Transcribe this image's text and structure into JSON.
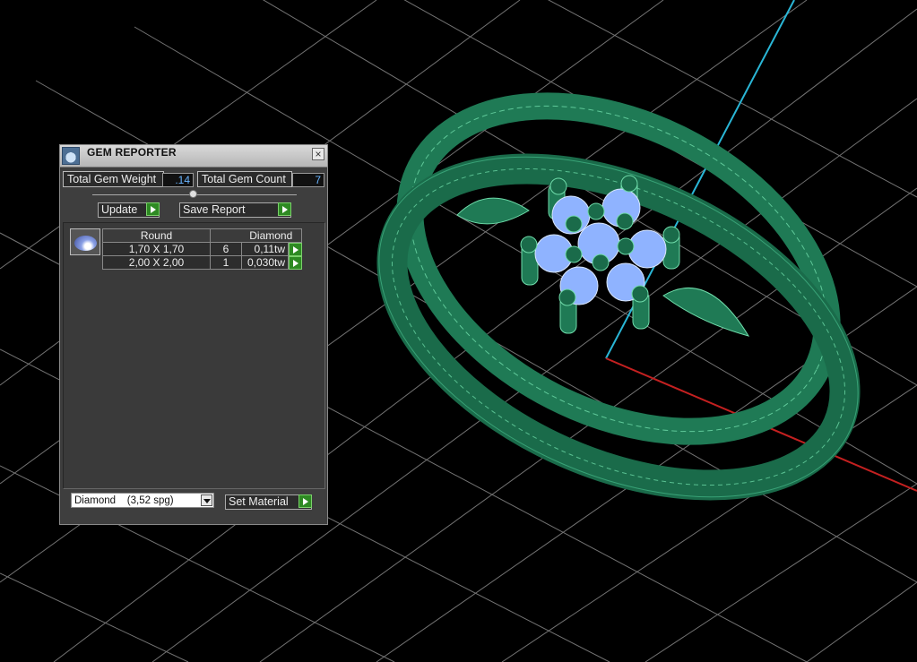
{
  "panel": {
    "title": "GEM REPORTER",
    "close_glyph": "×",
    "total_weight_label": "Total Gem Weight",
    "total_weight_value": ".14",
    "total_count_label": "Total Gem Count",
    "total_count_value": "7",
    "update_label": "Update",
    "save_report_label": "Save Report",
    "table": {
      "headers": [
        "Round",
        "",
        "Diamond"
      ],
      "rows": [
        {
          "size": "1,70 X 1,70",
          "qty": "6",
          "weight": "0,11tw"
        },
        {
          "size": "2,00 X 2,00",
          "qty": "1",
          "weight": "0,030tw"
        }
      ]
    },
    "material_selected": "Diamond    (3,52 spg)",
    "set_material_label": "Set Material"
  },
  "colors": {
    "metal": "#1f7a55",
    "metal_wire": "#6fdcaa",
    "gem": "#8fb3ff",
    "grid": "#9a9a9a",
    "axis_x": "#c42020",
    "axis_y": "#2ab6d6",
    "accent_play": "#2e8a23"
  },
  "icons": [
    "gem-reporter-app-icon",
    "close-icon",
    "play-icon",
    "round-gem-icon",
    "dropdown-arrow-icon"
  ]
}
